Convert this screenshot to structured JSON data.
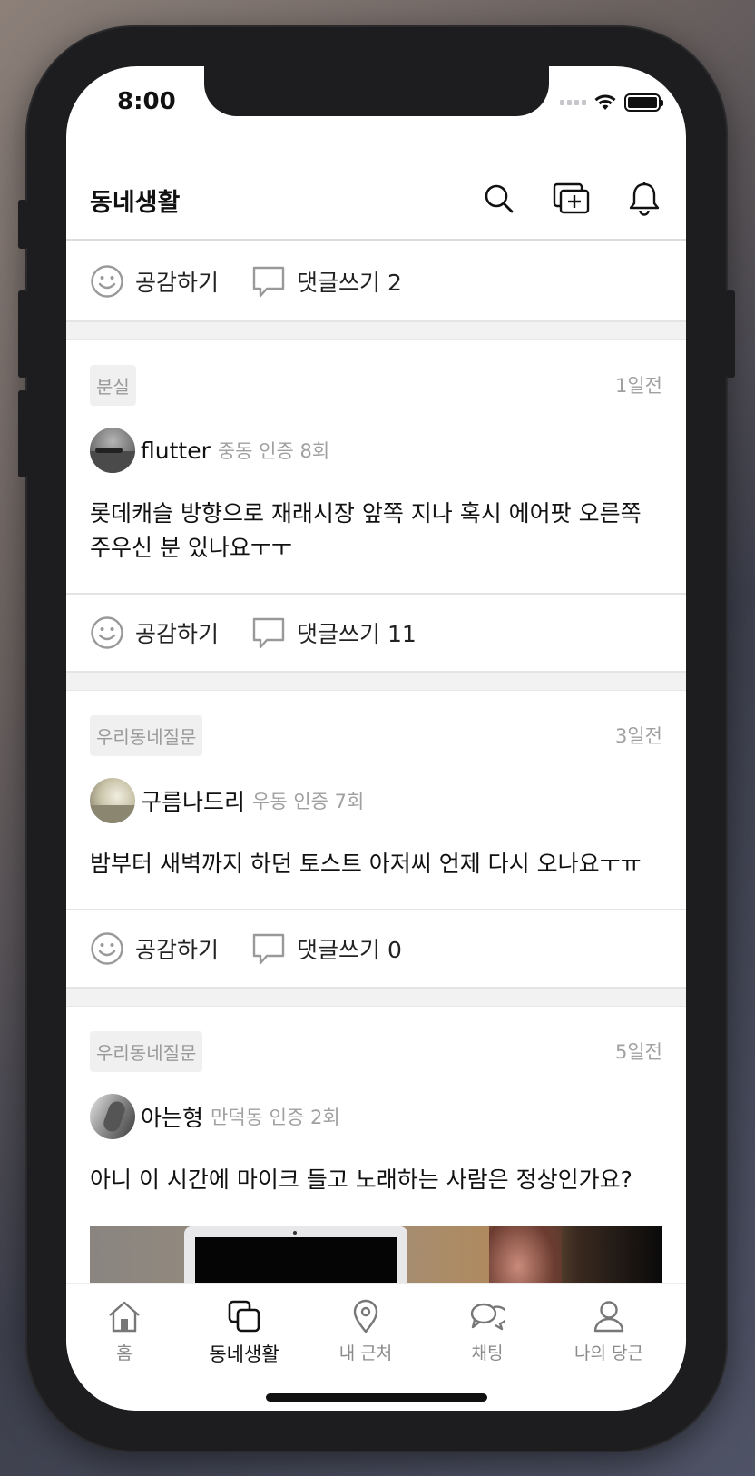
{
  "status_bar": {
    "time": "8:00"
  },
  "app_bar": {
    "title": "동네생활"
  },
  "first_actions": {
    "like_label": "공감하기",
    "comment_label": "댓글쓰기 2"
  },
  "posts": [
    {
      "tag": "분실",
      "time": "1일전",
      "author": "flutter",
      "meta": "중동 인증 8회",
      "text": "롯데캐슬 방향으로 재래시장 앞쪽 지나 혹시 에어팟 오른쪽 주우신 분 있나요ㅜㅜ",
      "like_label": "공감하기",
      "comment_label": "댓글쓰기 11"
    },
    {
      "tag": "우리동네질문",
      "time": "3일전",
      "author": "구름나드리",
      "meta": "우동 인증 7회",
      "text": "밤부터 새벽까지 하던 토스트 아저씨 언제 다시 오나요ㅜㅠ",
      "like_label": "공감하기",
      "comment_label": "댓글쓰기 0"
    },
    {
      "tag": "우리동네질문",
      "time": "5일전",
      "author": "아는형",
      "meta": "만덕동 인증 2회",
      "text": "아니 이 시간에 마이크 들고 노래하는 사람은 정상인가요?"
    }
  ],
  "tabs": [
    {
      "label": "홈",
      "icon": "home-icon"
    },
    {
      "label": "동네생활",
      "icon": "community-icon",
      "active": true
    },
    {
      "label": "내 근처",
      "icon": "location-pin-icon"
    },
    {
      "label": "채팅",
      "icon": "chat-icon"
    },
    {
      "label": "나의 당근",
      "icon": "person-icon"
    }
  ],
  "colors": {
    "accent": "#111111",
    "muted": "#a0a0a0",
    "tag_bg": "#f0f0f0",
    "divider": "#e4e4e4"
  }
}
